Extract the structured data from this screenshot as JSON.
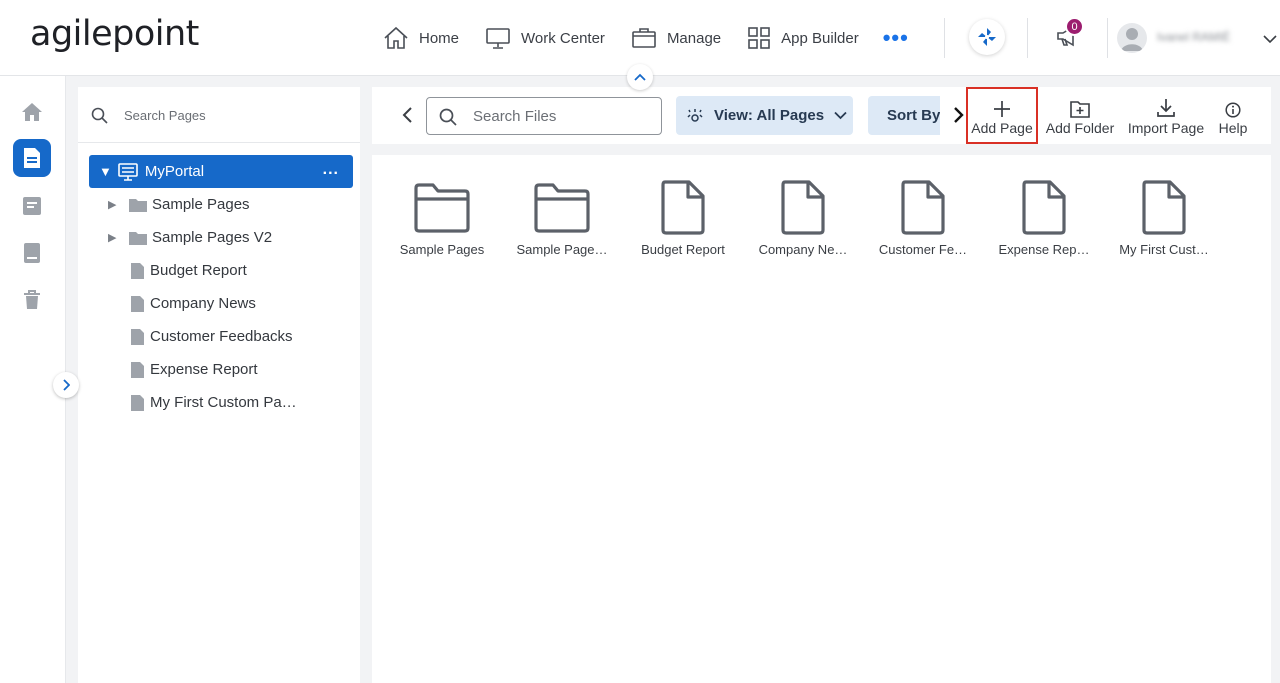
{
  "header": {
    "logo": "agilepoint",
    "nav": [
      {
        "label": "Home",
        "icon": "home-icon"
      },
      {
        "label": "Work Center",
        "icon": "monitor-icon"
      },
      {
        "label": "Manage",
        "icon": "briefcase-icon"
      },
      {
        "label": "App Builder",
        "icon": "grid-icon"
      }
    ],
    "more": "•••",
    "notifications_count": "0",
    "user_name": "Ivanel RAMIÉ",
    "colors": {
      "accent": "#1669c9",
      "badge": "#9c1d6f"
    }
  },
  "rail": {
    "items": [
      "home-icon",
      "page-icon",
      "form-icon",
      "book-icon",
      "trash-icon"
    ],
    "active": "page-icon"
  },
  "tree": {
    "search_placeholder": "Search Pages",
    "root": {
      "label": "MyPortal",
      "more": "..."
    },
    "items": [
      {
        "label": "Sample Pages",
        "type": "folder"
      },
      {
        "label": "Sample Pages V2",
        "type": "folder"
      },
      {
        "label": "Budget Report",
        "type": "page"
      },
      {
        "label": "Company News",
        "type": "page"
      },
      {
        "label": "Customer Feedbacks",
        "type": "page"
      },
      {
        "label": "Expense Report",
        "type": "page"
      },
      {
        "label": "My First Custom Pa…",
        "type": "page"
      }
    ]
  },
  "toolbar": {
    "search_placeholder": "Search Files",
    "view_label": "View: All Pages",
    "sort_label": "Sort By",
    "add_page": "Add Page",
    "add_folder": "Add Folder",
    "import_page": "Import Page",
    "help": "Help"
  },
  "content": {
    "tiles": [
      {
        "label": "Sample Pages",
        "type": "folder"
      },
      {
        "label": "Sample Page…",
        "type": "folder"
      },
      {
        "label": "Budget Report",
        "type": "page"
      },
      {
        "label": "Company Ne…",
        "type": "page"
      },
      {
        "label": "Customer Fe…",
        "type": "page"
      },
      {
        "label": "Expense Rep…",
        "type": "page"
      },
      {
        "label": "My First Cust…",
        "type": "page"
      }
    ]
  }
}
